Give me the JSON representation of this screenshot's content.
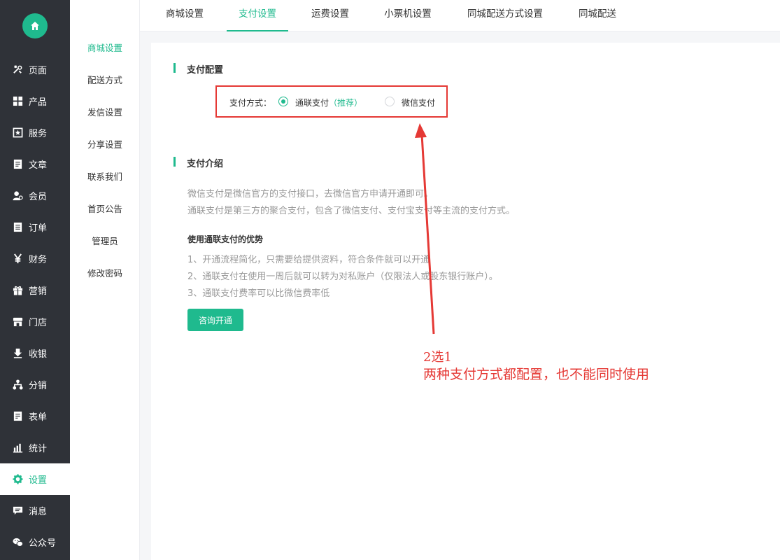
{
  "sidebar": {
    "home_icon": "home-icon",
    "items": [
      {
        "label": "页面",
        "icon": "tools-icon"
      },
      {
        "label": "产品",
        "icon": "grid-icon"
      },
      {
        "label": "服务",
        "icon": "star-badge-icon"
      },
      {
        "label": "文章",
        "icon": "document-icon"
      },
      {
        "label": "会员",
        "icon": "user-icon"
      },
      {
        "label": "订单",
        "icon": "list-icon"
      },
      {
        "label": "财务",
        "icon": "yen-icon"
      },
      {
        "label": "营销",
        "icon": "gift-icon"
      },
      {
        "label": "门店",
        "icon": "store-icon"
      },
      {
        "label": "收银",
        "icon": "download-icon"
      },
      {
        "label": "分销",
        "icon": "share-tree-icon"
      },
      {
        "label": "表单",
        "icon": "form-icon"
      },
      {
        "label": "统计",
        "icon": "bar-chart-icon"
      },
      {
        "label": "设置",
        "icon": "gear-icon"
      },
      {
        "label": "消息",
        "icon": "message-icon"
      },
      {
        "label": "公众号",
        "icon": "wechat-icon"
      }
    ],
    "active_index": 13
  },
  "subnav": {
    "items": [
      "商城设置",
      "配送方式",
      "发信设置",
      "分享设置",
      "联系我们",
      "首页公告",
      "管理员",
      "修改密码"
    ],
    "active_index": 0
  },
  "tabs": {
    "items": [
      "商城设置",
      "支付设置",
      "运费设置",
      "小票机设置",
      "同城配送方式设置",
      "同城配送"
    ],
    "active_index": 1
  },
  "pay_config": {
    "title": "支付配置",
    "label": "支付方式：",
    "options": [
      {
        "label": "通联支付",
        "tag": "（推荐）",
        "checked": true
      },
      {
        "label": "微信支付",
        "tag": "",
        "checked": false
      }
    ]
  },
  "pay_intro": {
    "title": "支付介绍",
    "lines": [
      "微信支付是微信官方的支付接口，去微信官方申请开通即可。",
      "通联支付是第三方的聚合支付，包含了微信支付、支付宝支付等主流的支付方式。"
    ],
    "advantages_title": "使用通联支付的优势",
    "advantages": [
      "1、开通流程简化，只需要给提供资料，符合条件就可以开通",
      "2、通联支付在使用一周后就可以转为对私账户（仅限法人或股东银行账户）。",
      "3、通联支付费率可以比微信费率低"
    ],
    "button": "咨询开通"
  },
  "annotation": {
    "line1": "2选1",
    "line2": "两种支付方式都配置，也不能同时使用",
    "color": "#e53935"
  },
  "colors": {
    "accent": "#1fba8e",
    "sidebar_bg": "#2f3238",
    "annotation_red": "#e53935"
  }
}
